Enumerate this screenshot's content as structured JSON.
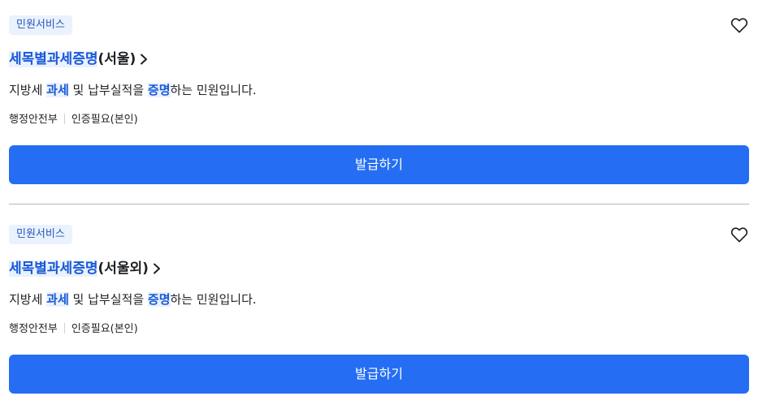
{
  "services": [
    {
      "category": "민원서비스",
      "title_highlight": "세목별과세증명",
      "title_rest": "(서울)",
      "desc_prefix": "지방세 ",
      "desc_kw1": "과세",
      "desc_mid": " 및 납부실적을 ",
      "desc_kw2": "증명",
      "desc_suffix": "하는 민원입니다.",
      "org": "행정안전부",
      "auth": "인증필요(본인)",
      "button_label": "발급하기"
    },
    {
      "category": "민원서비스",
      "title_highlight": "세목별과세증명",
      "title_rest": "(서울외)",
      "desc_prefix": "지방세 ",
      "desc_kw1": "과세",
      "desc_mid": " 및 납부실적을 ",
      "desc_kw2": "증명",
      "desc_suffix": "하는 민원입니다.",
      "org": "행정안전부",
      "auth": "인증필요(본인)",
      "button_label": "발급하기"
    }
  ],
  "icons": {
    "favorite": "heart-outline-icon",
    "title_arrow": "chevron-right-icon"
  },
  "colors": {
    "accent": "#256ef4",
    "highlight_text": "#1958d8",
    "highlight_bg": "#e9f2fd",
    "badge_bg": "#e9f2fd",
    "badge_text": "#2a56b8"
  }
}
